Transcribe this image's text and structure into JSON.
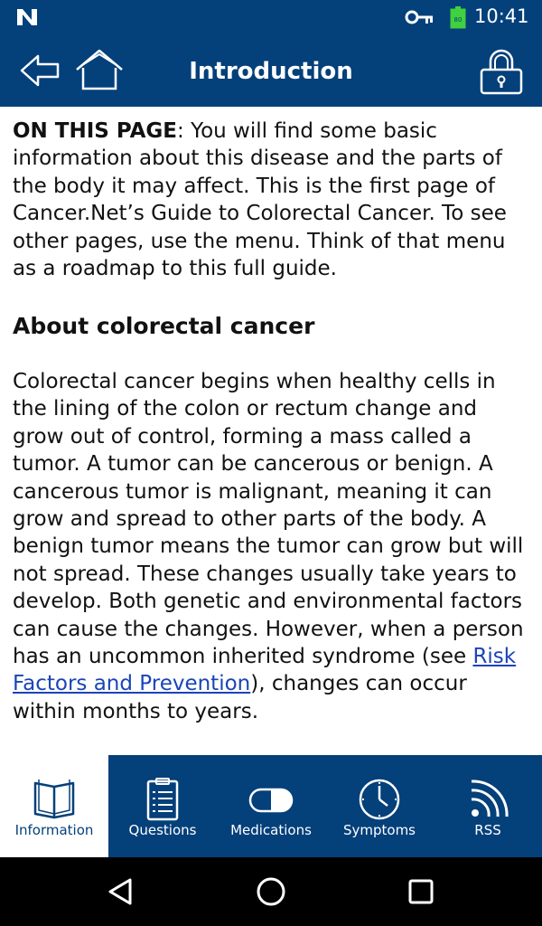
{
  "status_bar": {
    "battery_level": "80",
    "time": "10:41"
  },
  "app_bar": {
    "title": "Introduction"
  },
  "content": {
    "intro_label": "ON THIS PAGE",
    "intro_text": ": You will find some basic information about this disease and the parts of the body it may affect. This is the first page of Cancer.Net’s Guide to Colorectal Cancer. To see other pages, use the menu. Think of that menu as a roadmap to this full guide.",
    "section_heading": "About colorectal cancer",
    "body_before_link": "Colorectal cancer begins when healthy cells in the lining of the colon or rectum change and grow out of control, forming a mass called a tumor. A tumor can be cancerous or benign. A cancerous tumor is malignant, meaning it can grow and spread to other parts of the body. A benign tumor means the tumor can grow but will not spread. These changes usually take years to develop. Both genetic and environmental factors can cause the changes. However, when a person has an uncommon inherited syndrome (see ",
    "link_text": "Risk Factors and Prevention",
    "body_after_link": "), changes can occur within months to years."
  },
  "tabs": [
    {
      "label": "Information",
      "icon": "book-icon",
      "active": true
    },
    {
      "label": "Questions",
      "icon": "clipboard-icon",
      "active": false
    },
    {
      "label": "Medications",
      "icon": "pill-icon",
      "active": false
    },
    {
      "label": "Symptoms",
      "icon": "clock-icon",
      "active": false
    },
    {
      "label": "RSS",
      "icon": "rss-icon",
      "active": false
    }
  ],
  "nav_bar": {
    "icons": [
      "back-triangle-icon",
      "home-circle-icon",
      "recents-square-icon"
    ]
  },
  "colors": {
    "brand_blue": "#04407a",
    "link_blue": "#1a44b8"
  }
}
